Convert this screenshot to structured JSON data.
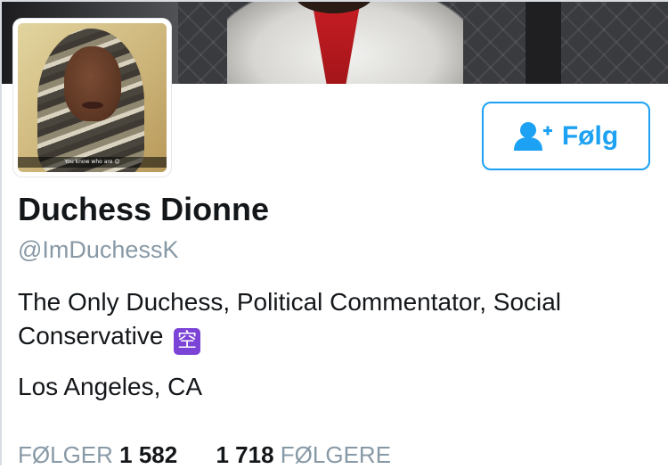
{
  "profile": {
    "display_name": "Duchess Dionne",
    "handle": "@ImDuchessK",
    "bio_text": "The Only Duchess, Political Commentator, Social Conservative",
    "bio_emoji": "空",
    "location": "Los Angeles, CA",
    "avatar_caption": "You know who are 😊"
  },
  "actions": {
    "follow_label": "Følg",
    "follow_icon": "add-user-icon"
  },
  "stats": {
    "following_label": "FØLGER",
    "following_count": "1 582",
    "followers_count": "1 718",
    "followers_label": "FØLGERE"
  },
  "colors": {
    "accent": "#1da1f2",
    "text_primary": "#14171a",
    "text_secondary": "#8899a6",
    "emoji_purple": "#7b43d6"
  }
}
